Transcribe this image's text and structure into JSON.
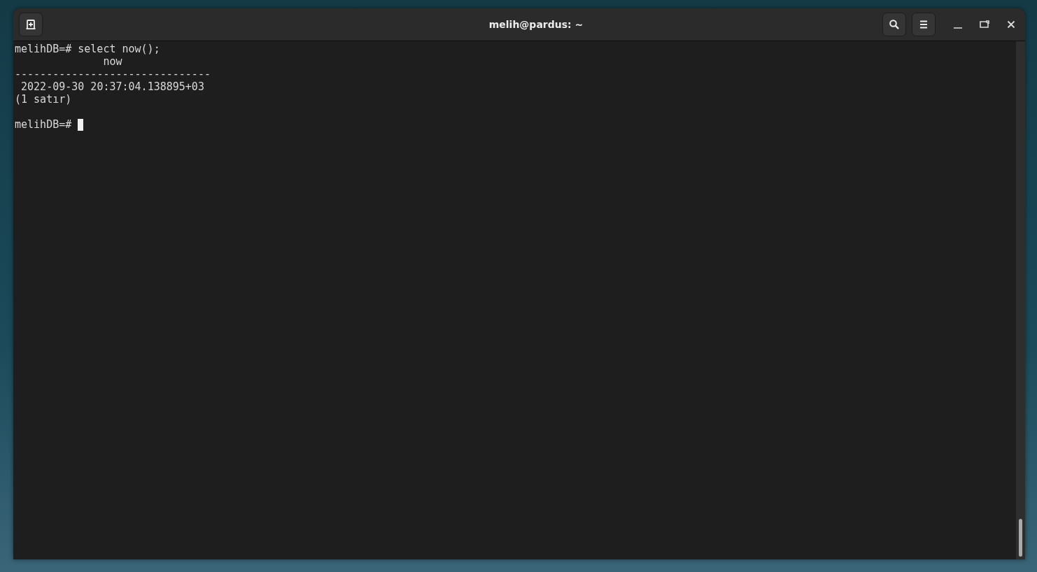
{
  "window": {
    "title": "melih@pardus: ~"
  },
  "terminal": {
    "lines": [
      {
        "kind": "prompt",
        "prompt": "melihDB=#",
        "command": "select now();",
        "cursor": false
      },
      {
        "kind": "output",
        "text": "              now"
      },
      {
        "kind": "output",
        "text": "-------------------------------"
      },
      {
        "kind": "output",
        "text": " 2022-09-30 20:37:04.138895+03"
      },
      {
        "kind": "output",
        "text": "(1 satır)"
      },
      {
        "kind": "blank"
      },
      {
        "kind": "prompt",
        "prompt": "melihDB=#",
        "cursor": true
      }
    ]
  }
}
